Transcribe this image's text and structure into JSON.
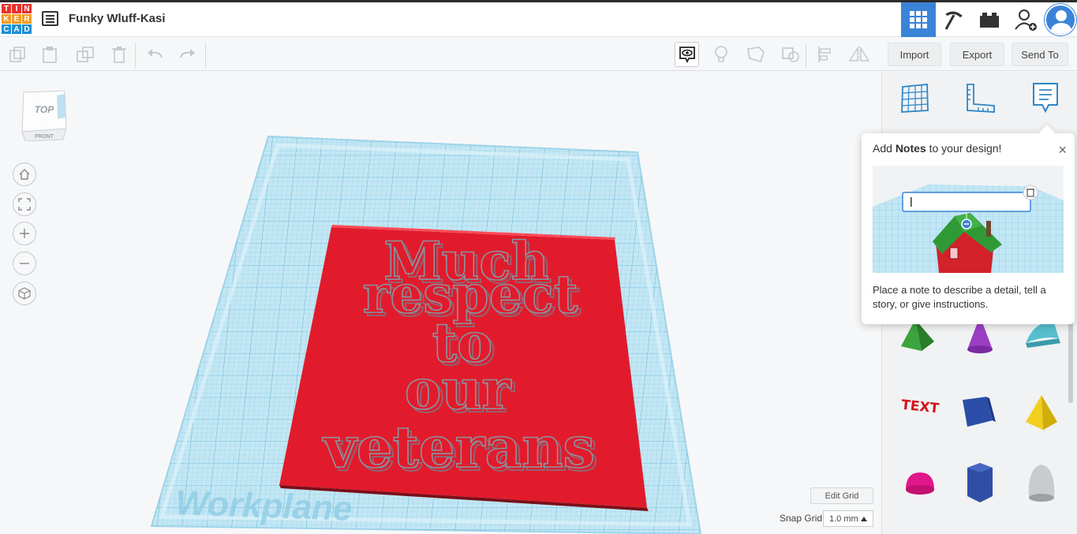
{
  "app": {
    "logo_letters": [
      "T",
      "I",
      "N",
      "K",
      "E",
      "R",
      "C",
      "A",
      "D"
    ],
    "logo_colors": [
      "#e5322d",
      "#e5322d",
      "#e5322d",
      "#f59b21",
      "#f59b21",
      "#f59b21",
      "#1c8ed6",
      "#1c8ed6",
      "#1c8ed6"
    ],
    "design_title": "Funky Wluff-Kasi"
  },
  "toolbar": {
    "import_label": "Import",
    "export_label": "Export",
    "send_to_label": "Send To"
  },
  "canvas": {
    "viewcube_top": "TOP",
    "viewcube_front": "FRONT",
    "workplane_label": "Workplane",
    "text_lines": [
      "Much",
      "respect",
      "to",
      "our",
      "veterans"
    ],
    "edit_grid_label": "Edit Grid",
    "snap_grid_label": "Snap Grid",
    "snap_grid_value": "1.0 mm"
  },
  "notes_popover": {
    "title_prefix": "Add ",
    "title_bold": "Notes",
    "title_suffix": " to your design!",
    "close_glyph": "×",
    "description": "Place a note to describe a detail, tell a story, or give instructions."
  },
  "colors": {
    "accent_blue": "#3a84d8",
    "workplane_blue": "#a6dcef",
    "box_red": "#e11b2c"
  }
}
